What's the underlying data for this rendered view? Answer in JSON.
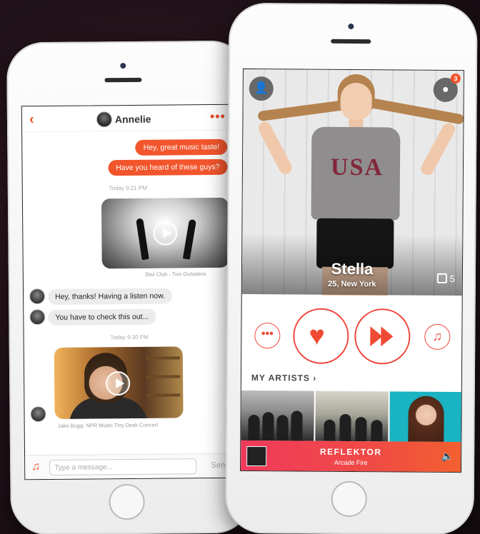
{
  "chat": {
    "contact_name": "Annelie",
    "back_icon": "‹",
    "more_icon": "•••",
    "messages_out": [
      "Hey, great music taste!",
      "Have you heard of these guys?"
    ],
    "timestamp_1": "Today 9:21 PM",
    "video1_caption": "Siwi Club - Two Outsiders",
    "messages_in": [
      "Hey, thanks! Having a listen now.",
      "You have to check this out..."
    ],
    "timestamp_2": "Today 9:30 PM",
    "video2_caption": "Jake Bugg: NPR Music Tiny Desk Concert",
    "input_placeholder": "Type a message...",
    "send_label": "Send",
    "music_icon": "♫"
  },
  "profile": {
    "name": "Stella",
    "subtitle": "25, New York",
    "photo_count": "5",
    "notification_count": "3",
    "shirt_text": "USA",
    "user_icon": "👤",
    "chat_icon": "●"
  },
  "actions": {
    "chat_icon": "•••",
    "like_icon": "♥",
    "music_icon": "♫"
  },
  "artists": {
    "title": "MY ARTISTS ›"
  },
  "now_playing": {
    "title": "REFLEKTOR",
    "artist": "Arcade Fire",
    "volume_icon": "🔈"
  },
  "colors": {
    "accent": "#f2552c",
    "like_red": "#f04a34",
    "now_playing_start": "#f03a5b",
    "now_playing_end": "#f2602f"
  }
}
